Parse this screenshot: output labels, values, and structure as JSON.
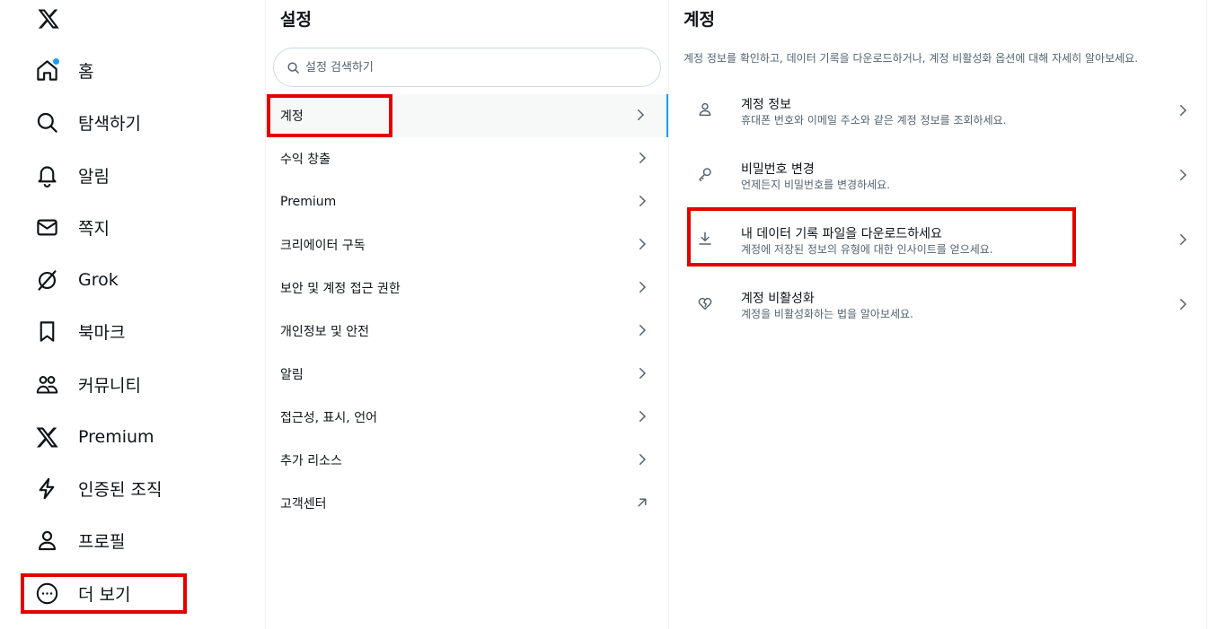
{
  "nav": {
    "logo": "x-logo-icon",
    "items": [
      {
        "label": "홈",
        "icon": "home-icon",
        "has_dot": true
      },
      {
        "label": "탐색하기",
        "icon": "search-icon"
      },
      {
        "label": "알림",
        "icon": "bell-icon"
      },
      {
        "label": "쪽지",
        "icon": "envelope-icon"
      },
      {
        "label": "Grok",
        "icon": "grok-icon"
      },
      {
        "label": "북마크",
        "icon": "bookmark-icon"
      },
      {
        "label": "커뮤니티",
        "icon": "people-icon"
      },
      {
        "label": "Premium",
        "icon": "x-logo-icon"
      },
      {
        "label": "인증된 조직",
        "icon": "lightning-icon"
      },
      {
        "label": "프로필",
        "icon": "person-icon"
      },
      {
        "label": "더 보기",
        "icon": "more-circle-icon"
      }
    ]
  },
  "settings": {
    "title": "설정",
    "search_placeholder": "설정 검색하기",
    "menu": [
      {
        "label": "계정",
        "active": true,
        "icon": "chevron-right-icon"
      },
      {
        "label": "수익 창출",
        "icon": "chevron-right-icon"
      },
      {
        "label": "Premium",
        "icon": "chevron-right-icon"
      },
      {
        "label": "크리에이터 구독",
        "icon": "chevron-right-icon"
      },
      {
        "label": "보안 및 계정 접근 권한",
        "icon": "chevron-right-icon"
      },
      {
        "label": "개인정보 및 안전",
        "icon": "chevron-right-icon"
      },
      {
        "label": "알림",
        "icon": "chevron-right-icon"
      },
      {
        "label": "접근성, 표시, 언어",
        "icon": "chevron-right-icon"
      },
      {
        "label": "추가 리소스",
        "icon": "chevron-right-icon"
      },
      {
        "label": "고객센터",
        "icon": "external-arrow-icon"
      }
    ]
  },
  "account": {
    "title": "계정",
    "description": "계정 정보를 확인하고, 데이터 기록을 다운로드하거나, 계정 비활성화 옵션에 대해 자세히 알아보세요.",
    "items": [
      {
        "name": "계정 정보",
        "sub": "휴대폰 번호와 이메일 주소와 같은 계정 정보를 조회하세요.",
        "icon": "person-icon"
      },
      {
        "name": "비밀번호 변경",
        "sub": "언제든지 비밀번호를 변경하세요.",
        "icon": "key-icon"
      },
      {
        "name": "내 데이터 기록 파일을 다운로드하세요",
        "sub": "계정에 저장된 정보의 유형에 대한 인사이트를 얻으세요.",
        "icon": "download-icon"
      },
      {
        "name": "계정 비활성화",
        "sub": "계정을 비활성화하는 법을 알아보세요.",
        "icon": "broken-heart-icon"
      }
    ]
  },
  "colors": {
    "accent": "#1d9bf0",
    "highlight_box": "#e50000",
    "text_primary": "#0f1419",
    "text_secondary": "#536471"
  }
}
